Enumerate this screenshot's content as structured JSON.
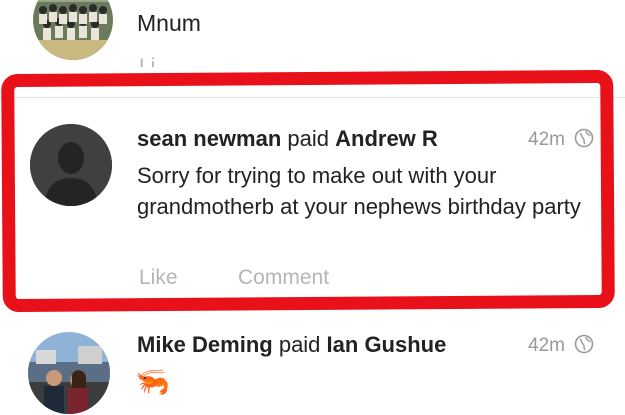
{
  "feed": {
    "items": [
      {
        "id": "top",
        "actor": "Mnum",
        "action_partial": "Li"
      },
      {
        "id": "main",
        "actor": "sean newman",
        "verb": "paid",
        "target": "Andrew R",
        "time": "42m",
        "message": "Sorry for trying to make out with your grandmotherb at your nephews birthday party",
        "like_label": "Like",
        "comment_label": "Comment"
      },
      {
        "id": "bottom",
        "actor": "Mike Deming",
        "verb": "paid",
        "target": "Ian Gushue",
        "time": "42m",
        "emoji": "🦐"
      }
    ]
  },
  "colors": {
    "highlight": "#e8111a",
    "muted_text": "#9a9a9a",
    "action_text": "#b5b5b5"
  },
  "icons": {
    "privacy": "globe-icon"
  }
}
